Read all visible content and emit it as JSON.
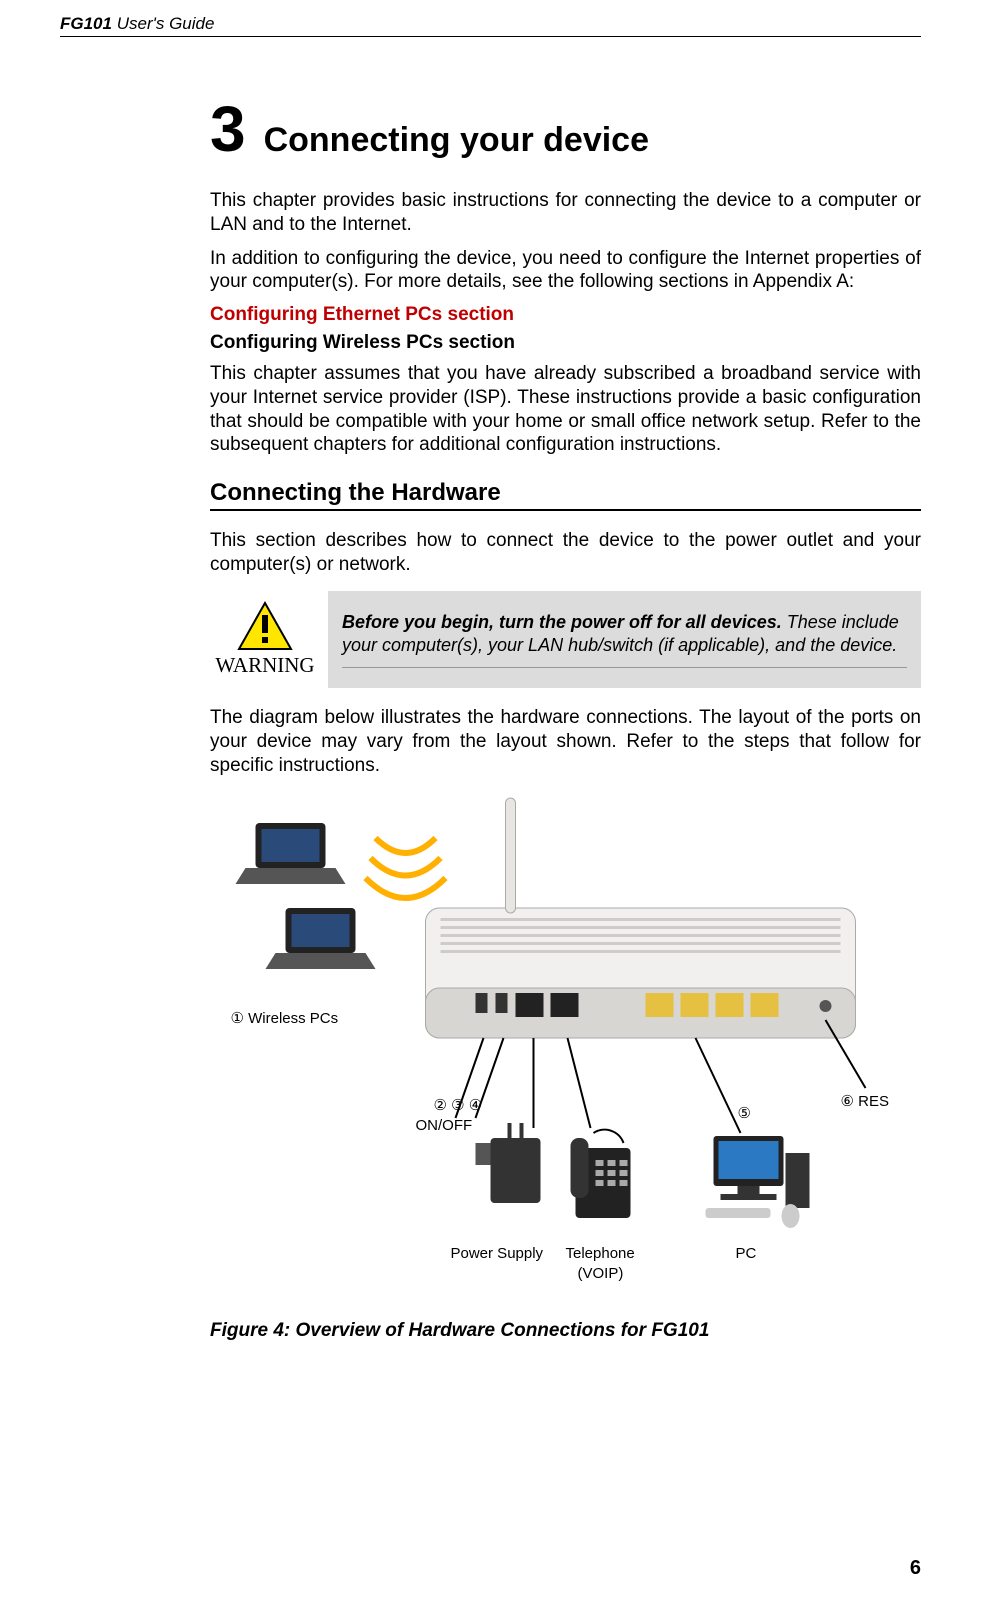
{
  "header": {
    "product_bold": "FG101",
    "product_rest": " User's Guide"
  },
  "chapter": {
    "number": "3",
    "title": "Connecting your device"
  },
  "intro": {
    "p1": "This chapter provides basic instructions for connecting the device to a computer or LAN and to the Internet.",
    "p2": "In addition to configuring the device, you need to configure the Internet properties of your computer(s). For more details, see the following sections in Appendix A:",
    "link_red": "Configuring Ethernet PCs section",
    "link_black": "Configuring Wireless PCs section",
    "p3": "This chapter assumes that you have already subscribed a broadband service with your Internet service provider (ISP). These instructions provide a basic configuration that should be compatible with your home or small office network setup. Refer to the subsequent chapters for additional configuration instructions."
  },
  "section": {
    "heading": "Connecting the Hardware",
    "p1": "This section describes how to connect the device to the power outlet and your computer(s) or network."
  },
  "warning": {
    "label": "WARNING",
    "bold": "Before you begin, turn the power off for all devices.",
    "rest": " These include your computer(s), your LAN hub/switch (if applicable), and the device.",
    "icon": "warning-icon"
  },
  "diagram_intro": "The diagram below illustrates the hardware connections. The layout of the ports on your device may vary from the layout shown. Refer to the steps that follow for specific instructions.",
  "diagram": {
    "labels": {
      "wireless": "① Wireless PCs",
      "onoff_nums": "②  ③    ④",
      "onoff": "ON/OFF",
      "power": "Power Supply",
      "phone1": "Telephone",
      "phone2": "(VOIP)",
      "pc": "PC",
      "five": "⑤",
      "res": "⑥ RES"
    }
  },
  "figure_caption": "Figure 4: Overview of Hardware Connections for FG101",
  "page_number": "6"
}
